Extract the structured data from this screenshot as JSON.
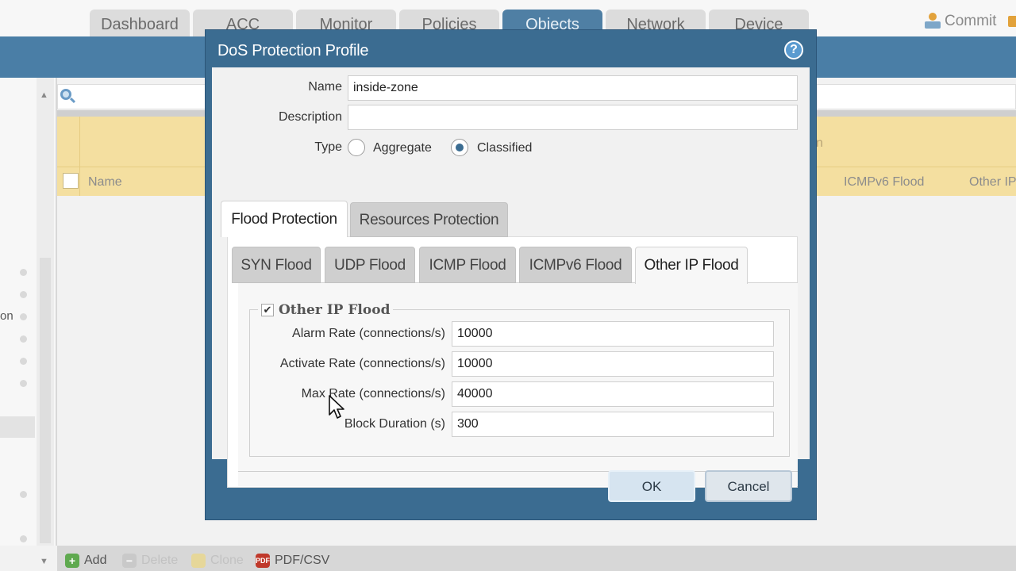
{
  "top_tabs": [
    {
      "label": "Dashboard",
      "active": false
    },
    {
      "label": "ACC",
      "active": false
    },
    {
      "label": "Monitor",
      "active": false
    },
    {
      "label": "Policies",
      "active": false
    },
    {
      "label": "Objects",
      "active": true
    },
    {
      "label": "Network",
      "active": false
    },
    {
      "label": "Device",
      "active": false
    }
  ],
  "commit_label": "Commit",
  "sidebar": {
    "partial_label": "on"
  },
  "grid": {
    "columns": [
      "Name",
      "ICMPv6 Flood",
      "Other IP"
    ],
    "partial_header": "n"
  },
  "bottom_toolbar": [
    {
      "label": "Add",
      "enabled": true,
      "icon": "add-icon",
      "color": "#5fa94f"
    },
    {
      "label": "Delete",
      "enabled": false,
      "icon": "delete-icon",
      "color": "#c9c9c9"
    },
    {
      "label": "Clone",
      "enabled": false,
      "icon": "clone-icon",
      "color": "#e6d79a"
    },
    {
      "label": "PDF/CSV",
      "enabled": true,
      "icon": "pdf-csv-icon",
      "color": "#c0392b"
    }
  ],
  "dialog": {
    "title": "DoS Protection Profile",
    "help_icon": "?",
    "name_label": "Name",
    "name_value": "inside-zone",
    "description_label": "Description",
    "description_value": "",
    "type_label": "Type",
    "type_options": [
      {
        "label": "Aggregate",
        "selected": false
      },
      {
        "label": "Classified",
        "selected": true
      }
    ],
    "main_tabs": [
      {
        "label": "Flood Protection",
        "active": true
      },
      {
        "label": "Resources Protection",
        "active": false
      }
    ],
    "sub_tabs": [
      {
        "label": "SYN Flood",
        "active": false
      },
      {
        "label": "UDP Flood",
        "active": false
      },
      {
        "label": "ICMP Flood",
        "active": false
      },
      {
        "label": "ICMPv6 Flood",
        "active": false
      },
      {
        "label": "Other IP Flood",
        "active": true
      }
    ],
    "section": {
      "checkbox_checked": true,
      "check_mark": "✔",
      "title": "Other IP Flood",
      "fields": [
        {
          "label": "Alarm Rate (connections/s)",
          "value": "10000"
        },
        {
          "label": "Activate Rate (connections/s)",
          "value": "10000"
        },
        {
          "label": "Max Rate (connections/s)",
          "value": "40000"
        },
        {
          "label": "Block Duration (s)",
          "value": "300"
        }
      ]
    },
    "ok_label": "OK",
    "cancel_label": "Cancel"
  },
  "colors": {
    "dialog_blue": "#3b6c91",
    "grid_header": "#f4dfa0",
    "active_tab": "#4f7fa4"
  }
}
